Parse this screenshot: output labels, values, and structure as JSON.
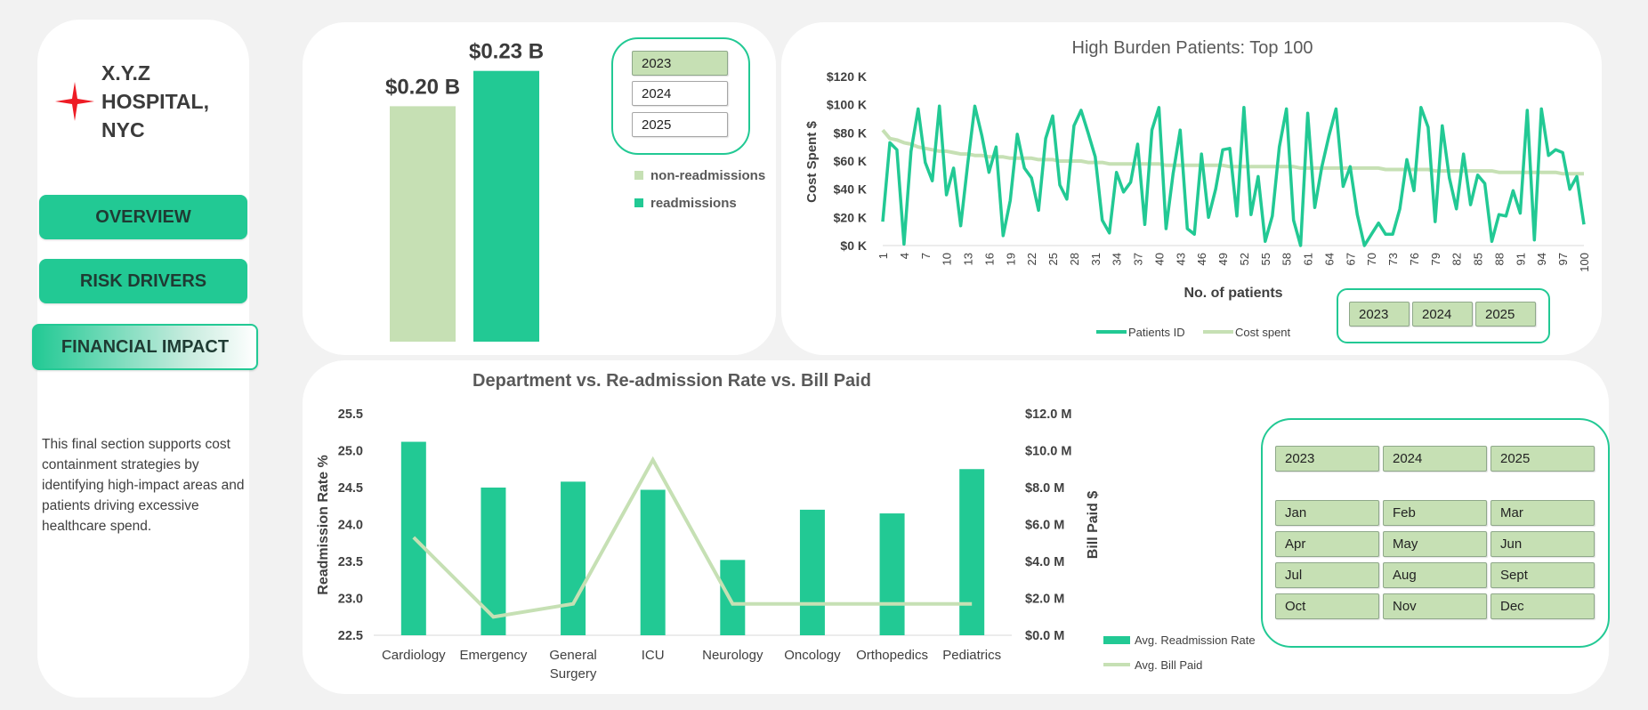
{
  "sidebar": {
    "hospital_line1": "X.Y.Z",
    "hospital_line2": "HOSPITAL,",
    "hospital_line3": "NYC",
    "nav": [
      "OVERVIEW",
      "RISK DRIVERS",
      "FINANCIAL IMPACT"
    ],
    "description": "This final section supports cost containment strategies by identifying high-impact areas and patients driving excessive healthcare spend."
  },
  "colors": {
    "accent": "#22c994",
    "light_green": "#c6e0b4",
    "bg": "#f2f2f2"
  },
  "summary_slicer": {
    "years": [
      "2023",
      "2024",
      "2025"
    ],
    "selected": "2023"
  },
  "burden_slicer": {
    "years": [
      "2023",
      "2024",
      "2025"
    ]
  },
  "dept_slicer": {
    "years": [
      "2023",
      "2024",
      "2025"
    ],
    "months": [
      "Jan",
      "Feb",
      "Mar",
      "Apr",
      "May",
      "Jun",
      "Jul",
      "Aug",
      "Sept",
      "Oct",
      "Nov",
      "Dec"
    ]
  },
  "chart_data": [
    {
      "type": "bar",
      "categories": [
        "non-readmissions",
        "readmissions"
      ],
      "values": [
        0.2,
        0.23
      ],
      "data_labels": [
        "$0.20 B",
        "$0.23 B"
      ],
      "colors": [
        "#c6e0b4",
        "#22c994"
      ],
      "legend": [
        "non-readmissions",
        "readmissions"
      ],
      "legend_position": "right",
      "ylim": [
        0,
        0.26
      ]
    },
    {
      "type": "line",
      "title": "High Burden Patients: Top 100",
      "xlabel": "No. of patients",
      "ylabel": "Cost Spent $",
      "ylim": [
        0,
        120000
      ],
      "y_ticks": [
        "$0 K",
        "$20 K",
        "$40 K",
        "$60 K",
        "$80 K",
        "$100 K",
        "$120 K"
      ],
      "x_ticks": [
        "1",
        "4",
        "7",
        "10",
        "13",
        "16",
        "19",
        "22",
        "25",
        "28",
        "31",
        "34",
        "37",
        "40",
        "43",
        "46",
        "49",
        "52",
        "55",
        "58",
        "61",
        "64",
        "67",
        "70",
        "73",
        "76",
        "79",
        "82",
        "85",
        "88",
        "91",
        "94",
        "97",
        "100"
      ],
      "legend_position": "bottom",
      "series": [
        {
          "name": "Patients ID",
          "color": "#22c994",
          "values": [
            17000,
            73000,
            68000,
            1000,
            67000,
            97000,
            59000,
            46000,
            99000,
            36000,
            55000,
            14000,
            58000,
            99000,
            78000,
            52000,
            70000,
            7000,
            32000,
            79000,
            55000,
            48000,
            25000,
            76000,
            92000,
            43000,
            33000,
            85000,
            96000,
            80000,
            63000,
            18000,
            9000,
            52000,
            38000,
            45000,
            72000,
            15000,
            82000,
            98000,
            12000,
            51000,
            82000,
            12000,
            8000,
            65000,
            20000,
            40000,
            68000,
            69000,
            21000,
            98000,
            22000,
            49000,
            3000,
            21000,
            70000,
            97000,
            18000,
            0,
            94000,
            27000,
            56000,
            78000,
            97000,
            42000,
            56000,
            22000,
            0,
            8000,
            16000,
            8000,
            8000,
            26000,
            61000,
            39000,
            98000,
            84000,
            17000,
            85000,
            48000,
            26000,
            65000,
            29000,
            50000,
            44000,
            3000,
            22000,
            21000,
            39000,
            23000,
            96000,
            4000,
            97000,
            64000,
            68000,
            66000,
            40000,
            49000,
            15000
          ]
        },
        {
          "name": "Cost spent",
          "color": "#c6e0b4",
          "values": [
            82000,
            76000,
            75000,
            73000,
            72000,
            70000,
            69000,
            68000,
            67000,
            67000,
            66000,
            65000,
            65000,
            64000,
            64000,
            63000,
            63000,
            63000,
            62000,
            62000,
            62000,
            62000,
            61000,
            61000,
            61000,
            60000,
            60000,
            60000,
            60000,
            59000,
            59000,
            59000,
            58000,
            58000,
            58000,
            58000,
            58000,
            58000,
            58000,
            58000,
            57000,
            57000,
            57000,
            57000,
            57000,
            57000,
            57000,
            57000,
            57000,
            56000,
            56000,
            56000,
            56000,
            56000,
            56000,
            56000,
            56000,
            56000,
            56000,
            55000,
            55000,
            55000,
            55000,
            55000,
            55000,
            55000,
            55000,
            55000,
            55000,
            55000,
            55000,
            54000,
            54000,
            54000,
            54000,
            54000,
            54000,
            54000,
            53000,
            53000,
            53000,
            53000,
            53000,
            53000,
            53000,
            53000,
            53000,
            52000,
            52000,
            52000,
            52000,
            52000,
            52000,
            52000,
            52000,
            52000,
            51000,
            51000,
            51000,
            51000
          ]
        }
      ]
    },
    {
      "type": "bar",
      "title": "Department vs. Re-admission Rate vs. Bill Paid",
      "categories": [
        "Cardiology",
        "Emergency",
        "General Surgery",
        "ICU",
        "Neurology",
        "Oncology",
        "Orthopedics",
        "Pediatrics"
      ],
      "ylabel": "Readmission Rate %",
      "y2label": "Bill Paid $",
      "ylim": [
        22.5,
        25.5
      ],
      "y2lim": [
        0,
        12
      ],
      "y_ticks": [
        "22.5",
        "23.0",
        "23.5",
        "24.0",
        "24.5",
        "25.0",
        "25.5"
      ],
      "y2_ticks": [
        "$0.0 M",
        "$2.0 M",
        "$4.0 M",
        "$6.0 M",
        "$8.0 M",
        "$10.0 M",
        "$12.0 M"
      ],
      "legend_position": "bottom-right",
      "series": [
        {
          "name": "Avg. Readmission Rate",
          "type": "bar",
          "color": "#22c994",
          "values": [
            25.12,
            24.5,
            24.58,
            24.47,
            23.52,
            24.2,
            24.15,
            24.75
          ]
        },
        {
          "name": "Avg. Bill Paid",
          "type": "line",
          "color": "#c6e0b4",
          "values": [
            5.3,
            1.0,
            1.7,
            9.5,
            1.7,
            1.7,
            1.7,
            1.7
          ]
        }
      ]
    }
  ]
}
